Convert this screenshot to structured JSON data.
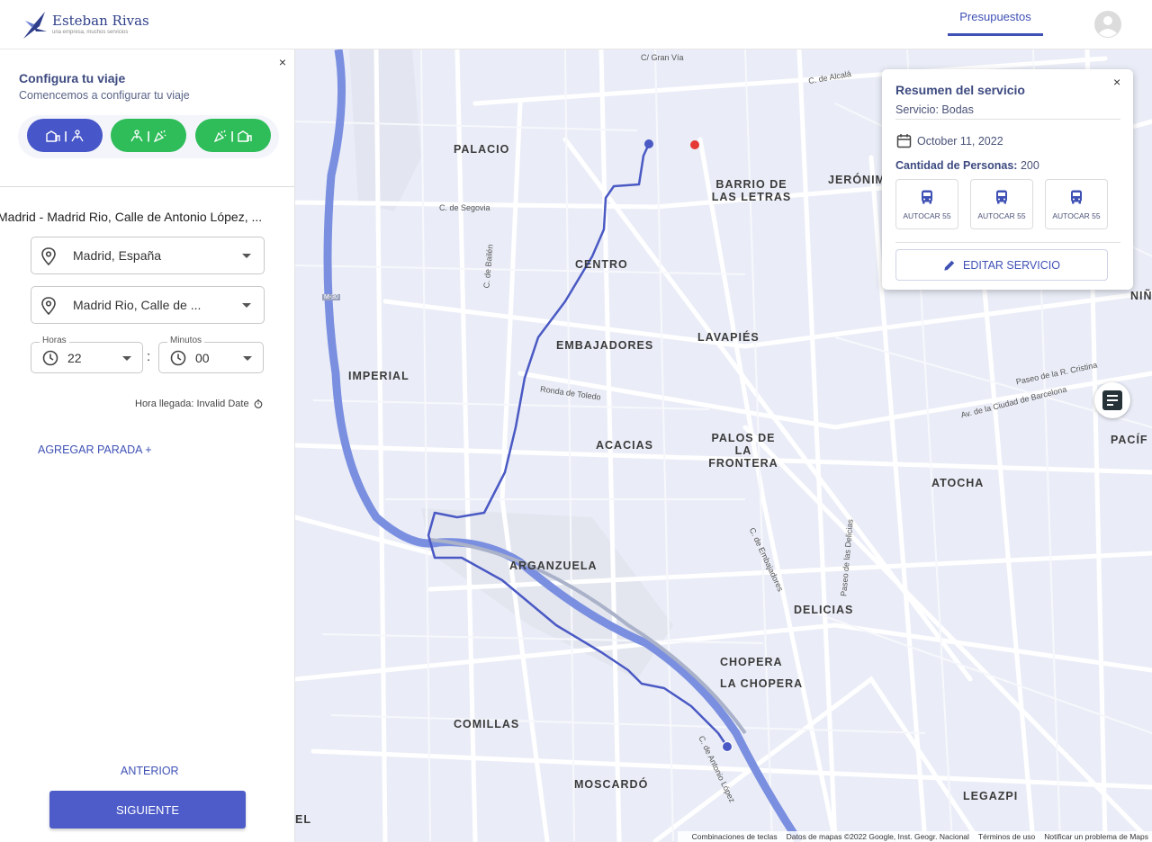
{
  "header": {
    "brand_name": "Esteban Rivas",
    "brand_tagline": "una empresa, muchos servicios",
    "nav_tab": "Presupuestos"
  },
  "sidebar": {
    "close": "×",
    "title": "Configura tu viaje",
    "subtitle": "Comencemos a configurar tu viaje",
    "trip_modes": [
      {
        "icon": "building-to-people-icon",
        "active": true
      },
      {
        "icon": "people-to-party-icon",
        "active": false
      },
      {
        "icon": "party-to-building-icon",
        "active": false
      }
    ],
    "route_title": "Madrid - Madrid Rio, Calle de Antonio López, ...",
    "origin": "Madrid, España",
    "destination": "Madrid Rio, Calle de ...",
    "hours_label": "Horas",
    "hours_value": "22",
    "time_separator": ":",
    "minutes_label": "Minutos",
    "minutes_value": "00",
    "arrival": "Hora llegada: Invalid Date",
    "add_stop": "AGREGAR PARADA +",
    "prev_button": "ANTERIOR",
    "next_button": "SIGUIENTE"
  },
  "map": {
    "districts": [
      "PALACIO",
      "BARRIO DE LAS LETRAS",
      "JERÓNIM",
      "CENTRO",
      "EMBAJADORES",
      "LAVAPIÉS",
      "IMPERIAL",
      "ACACIAS",
      "PALOS DE LA FRONTERA",
      "ATOCHA",
      "PACÍF",
      "ARGANZUELA",
      "DELICIAS",
      "CHOPERA",
      "LA CHOPERA",
      "COMILLAS",
      "MOSCARDÓ",
      "LEGAZPI",
      "NIÑ",
      "EL"
    ],
    "streets": [
      "C. de Alcalá",
      "C/ Gran Vía",
      "C. de Segovia",
      "Ronda de Toledo",
      "Av. de la Ciudad de Barcelona",
      "C. de Antonio López",
      "Paseo de las Delicias",
      "Paseo de la R. Cristina",
      "C. de Embajadores",
      "C. de Bailén",
      "M-30"
    ],
    "footer": [
      "Combinaciones de teclas",
      "Datos de mapas ©2022 Google, Inst. Geogr. Nacional",
      "Términos de uso",
      "Notificar un problema de Maps"
    ],
    "colors": {
      "route": "#4a59c4",
      "river": "#7b8fe0",
      "origin_marker": "#4a59c4",
      "destination_marker": "#e53935"
    }
  },
  "summary": {
    "title": "Resumen del servicio",
    "service": "Servicio: Bodas",
    "date": "October 11, 2022",
    "people_label": "Cantidad de Personas:",
    "people_value": "200",
    "buses": [
      "AUTOCAR 55",
      "AUTOCAR 55",
      "AUTOCAR 55"
    ],
    "edit_button": "EDITAR SERVICIO",
    "close": "×"
  }
}
